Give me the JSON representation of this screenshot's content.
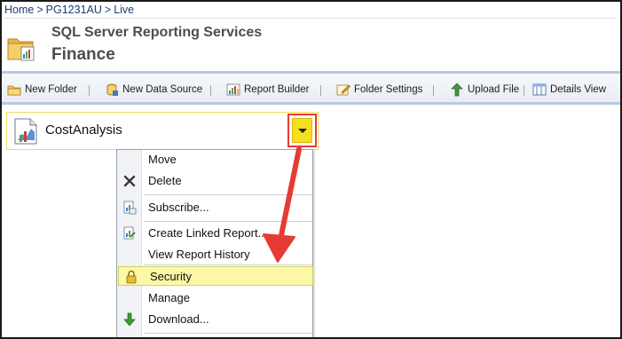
{
  "breadcrumb": {
    "items": [
      "Home",
      "PG1231AU",
      "Live"
    ],
    "separator": ">"
  },
  "header": {
    "app_title": "SQL Server Reporting Services",
    "page_title": "Finance",
    "icon": "folder-report-icon"
  },
  "toolbar": {
    "items": [
      {
        "label": "New Folder",
        "icon": "new-folder-icon"
      },
      {
        "label": "New Data Source",
        "icon": "new-data-source-icon"
      },
      {
        "label": "Report Builder",
        "icon": "report-builder-icon"
      },
      {
        "label": "Folder Settings",
        "icon": "folder-settings-icon"
      },
      {
        "label": "Upload File",
        "icon": "upload-file-icon"
      },
      {
        "label": "Details View",
        "icon": "details-view-icon"
      }
    ]
  },
  "item": {
    "name": "CostAnalysis",
    "icon": "report-icon"
  },
  "context_menu": {
    "items": [
      {
        "label": "Move"
      },
      {
        "label": "Delete",
        "icon": "delete-x-icon"
      },
      {
        "label": "Subscribe...",
        "icon": "subscribe-icon"
      },
      {
        "label": "Create Linked Report...",
        "icon": "linked-report-icon"
      },
      {
        "label": "View Report History"
      },
      {
        "label": "Security",
        "icon": "lock-icon",
        "highlighted": true
      },
      {
        "label": "Manage"
      },
      {
        "label": "Download...",
        "icon": "download-icon"
      }
    ]
  },
  "colors": {
    "highlight": "#fdf8a6",
    "annotation_arrow": "#e53b34",
    "dropdown_button": "#f6df1c",
    "toolbar_border": "#b9c9de",
    "title_text": "#4d4d4d",
    "link_text": "#1a3f75"
  }
}
